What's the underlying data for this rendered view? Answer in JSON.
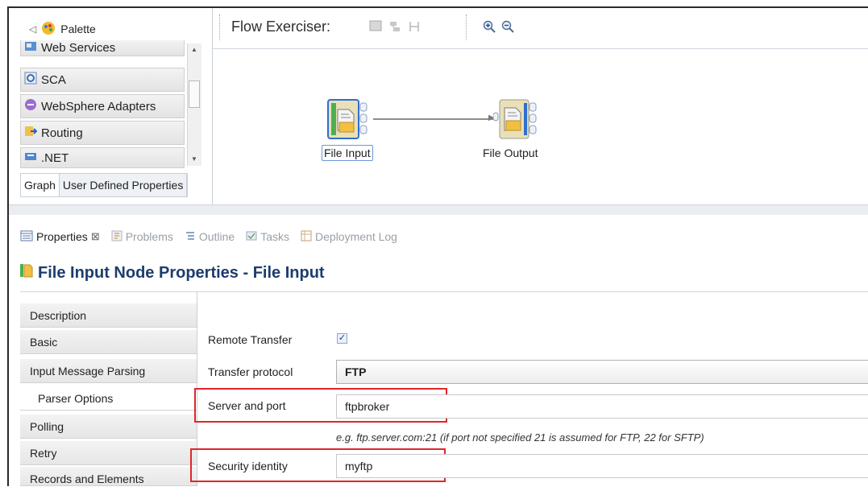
{
  "palette": {
    "header_label": "Palette",
    "items": [
      {
        "label": "Web Services",
        "icon": "web-services-icon"
      },
      {
        "label": "SCA",
        "icon": "sca-icon"
      },
      {
        "label": "WebSphere Adapters",
        "icon": "websphere-adapters-icon"
      },
      {
        "label": "Routing",
        "icon": "routing-icon"
      },
      {
        "label": ".NET",
        "icon": "dotnet-icon"
      }
    ]
  },
  "editor_tabs": [
    "Graph",
    "User Defined Properties"
  ],
  "canvas": {
    "flow_exerciser_label": "Flow Exerciser:",
    "nodes": [
      {
        "label": "File Input"
      },
      {
        "label": "File Output"
      }
    ]
  },
  "views": {
    "tabs": [
      {
        "label": "Properties",
        "icon": "properties-icon",
        "active": true,
        "close": "⊠"
      },
      {
        "label": "Problems",
        "icon": "problems-icon"
      },
      {
        "label": "Outline",
        "icon": "outline-icon"
      },
      {
        "label": "Tasks",
        "icon": "tasks-icon"
      },
      {
        "label": "Deployment Log",
        "icon": "deployment-log-icon"
      }
    ]
  },
  "properties": {
    "title": "File Input Node Properties - File Input",
    "sections": [
      "Description",
      "Basic",
      "Input Message Parsing",
      "Parser Options",
      "Polling",
      "Retry",
      "Records and Elements"
    ],
    "selected_section": "Parser Options",
    "fields": {
      "remote_transfer": {
        "label": "Remote Transfer",
        "checked": true
      },
      "transfer_protocol": {
        "label": "Transfer protocol",
        "value": "FTP"
      },
      "server_and_port": {
        "label": "Server and port",
        "value": "ftpbroker",
        "hint": "e.g. ftp.server.com:21 (if port not specified 21 is assumed for FTP, 22 for SFTP)"
      },
      "security_identity": {
        "label": "Security identity",
        "value": "myftp"
      }
    }
  },
  "colors": {
    "highlight": "#e0262a",
    "title": "#1c3d6e",
    "checkbox": "#e9f0fb"
  }
}
